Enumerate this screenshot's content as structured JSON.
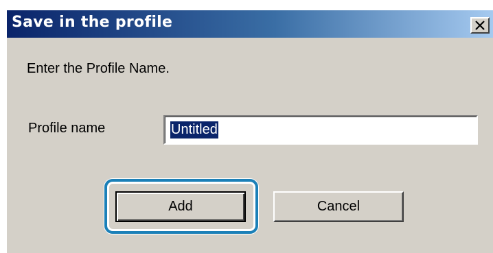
{
  "window": {
    "title": "Save in the profile",
    "close_label": "close"
  },
  "dialog": {
    "instruction": "Enter the Profile Name.",
    "profile_label": "Profile name",
    "profile_value": "Untitled"
  },
  "buttons": {
    "add": "Add",
    "cancel": "Cancel"
  },
  "colors": {
    "title_bar_start": "#0a246a",
    "title_bar_end": "#a6caf0",
    "dialog_face": "#d4d0c8",
    "highlight": "#1b80b8",
    "selection": "#0a246a"
  },
  "annotation": {
    "highlighted_element": "add-button",
    "style": "rounded-rectangle"
  }
}
